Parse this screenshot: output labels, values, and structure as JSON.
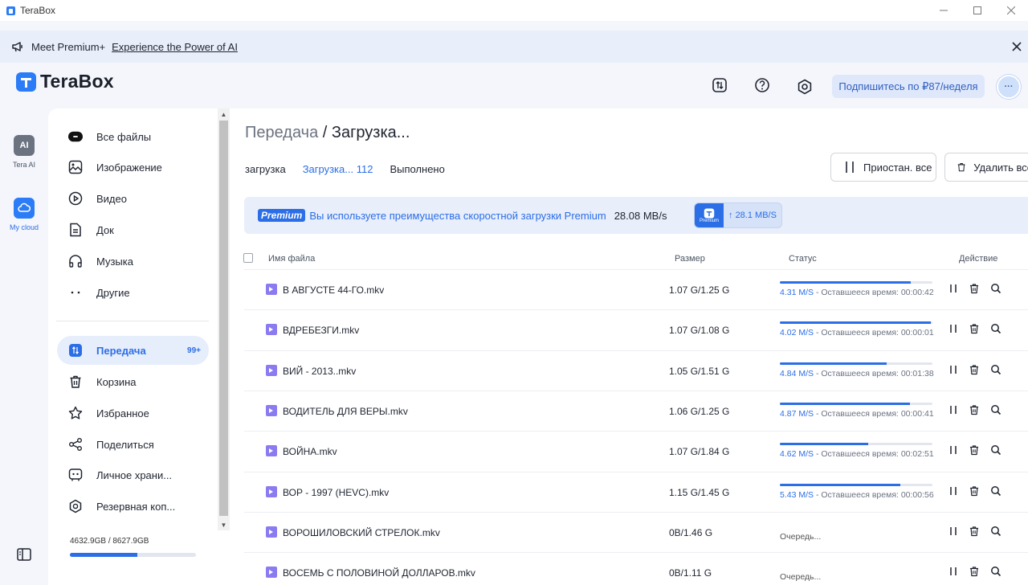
{
  "window": {
    "title": "TeraBox",
    "minimize": "—",
    "maximize": "☐",
    "close": "✕"
  },
  "banner": {
    "text1": "Meet Premium+",
    "text2": "Experience the Power of AI"
  },
  "header": {
    "logo": "TeraBox",
    "subscribe": "Подпишитесь по ₽87/неделя",
    "avatar": "···"
  },
  "rail": {
    "ai_label": "Tera AI",
    "cloud_label": "My cloud",
    "ai_box": "AI"
  },
  "sidebar": {
    "items": [
      {
        "label": "Все файлы",
        "icon": "all-files-icon"
      },
      {
        "label": "Изображение",
        "icon": "image-icon"
      },
      {
        "label": "Видео",
        "icon": "video-icon"
      },
      {
        "label": "Док",
        "icon": "document-icon"
      },
      {
        "label": "Музыка",
        "icon": "headphones-icon"
      },
      {
        "label": "Другие",
        "icon": "more-icon"
      },
      {
        "label": "Передача",
        "icon": "transfer-icon",
        "badge": "99+",
        "active": true
      },
      {
        "label": "Корзина",
        "icon": "trash-icon"
      },
      {
        "label": "Избранное",
        "icon": "star-icon"
      },
      {
        "label": "Поделиться",
        "icon": "share-icon"
      },
      {
        "label": "Личное храни...",
        "icon": "vault-icon"
      },
      {
        "label": "Резервная коп...",
        "icon": "backup-icon"
      }
    ],
    "storage": {
      "text": "4632.9GB / 8627.9GB",
      "used_fraction": 0.537
    }
  },
  "main": {
    "breadcrumb": {
      "parent": "Передача",
      "sep": " / ",
      "current": "Загрузка..."
    },
    "tabs": [
      {
        "label": "загрузка",
        "active": false
      },
      {
        "label": "Загрузка... 112",
        "active": true
      },
      {
        "label": "Выполнено",
        "active": false
      }
    ],
    "pause_all": "Приостан. все",
    "delete_all": "Удалить все",
    "speedbar": {
      "badge": "Premium",
      "text": "Вы используете преимущества скоростной загрузки Premium",
      "speed": "28.08 MB/s",
      "pill_logo": "Premium",
      "pill_speed": "28.1 MB/S"
    },
    "columns": {
      "name": "Имя файла",
      "size": "Размер",
      "status": "Статус",
      "action": "Действие"
    },
    "rows": [
      {
        "name": "В АВГУСТЕ 44-ГО.mkv",
        "size": "1.07 G/1.25 G",
        "progress": 0.86,
        "speed": "4.31 M/S",
        "remaining": " - Оставшееся время: 00:00:42"
      },
      {
        "name": "ВДРЕБЕЗГИ.mkv",
        "size": "1.07 G/1.08 G",
        "progress": 0.99,
        "speed": "4.02 M/S",
        "remaining": " - Оставшееся время: 00:00:01"
      },
      {
        "name": "ВИЙ - 2013..mkv",
        "size": "1.05 G/1.51 G",
        "progress": 0.7,
        "speed": "4.84 M/S",
        "remaining": " - Оставшееся время: 00:01:38"
      },
      {
        "name": "ВОДИТЕЛЬ ДЛЯ ВЕРЫ.mkv",
        "size": "1.06 G/1.25 G",
        "progress": 0.85,
        "speed": "4.87 M/S",
        "remaining": " - Оставшееся время: 00:00:41"
      },
      {
        "name": "ВОЙНА.mkv",
        "size": "1.07 G/1.84 G",
        "progress": 0.58,
        "speed": "4.62 M/S",
        "remaining": " - Оставшееся время: 00:02:51"
      },
      {
        "name": "ВОР - 1997 (HEVC).mkv",
        "size": "1.15 G/1.45 G",
        "progress": 0.79,
        "speed": "5.43 M/S",
        "remaining": " - Оставшееся время: 00:00:56"
      },
      {
        "name": "ВОРОШИЛОВСКИЙ СТРЕЛОК.mkv",
        "size": "0B/1.46 G",
        "queued": "Очередь..."
      },
      {
        "name": "ВОСЕМЬ С ПОЛОВИНОЙ ДОЛЛАРОВ.mkv",
        "size": "0B/1.11 G",
        "queued": "Очередь..."
      }
    ]
  },
  "colors": {
    "accent": "#2b6ee6",
    "banner_bg": "#e8eefa",
    "file_icon": "#8b7bf0"
  }
}
